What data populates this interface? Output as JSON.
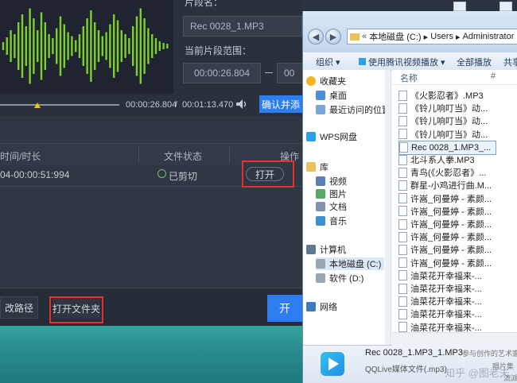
{
  "app": {
    "segment_name_label": "片段名：",
    "segment_name_value": "Rec 0028_1.MP3",
    "range_label": "当前片段范围：",
    "range_start": "00:00:26.804",
    "range_end_partial": "00",
    "current_time": "00:00:26.804",
    "total_time": "00:01:13.470",
    "confirm_button": "确认并添",
    "table": {
      "headers": {
        "time": "时间/时长",
        "status": "文件状态",
        "action": "操作"
      },
      "rows": [
        {
          "time": "04-00:00:51:994",
          "status": "已剪切",
          "action": "打开"
        }
      ]
    },
    "bottom": {
      "change_path": "改路径",
      "open_folder": "打开文件夹",
      "start_partial": "开"
    },
    "colors": {
      "accent": "#2f7ef0",
      "wave": "#7bcf2e",
      "highlight": "#e0332d"
    }
  },
  "explorer": {
    "address": {
      "part1": "本地磁盘 (C:)",
      "part2": "Users",
      "part3": "Administrator"
    },
    "commands": [
      "组织 ▾",
      "使用腾讯视频播放 ▾",
      "全部播放",
      "共享"
    ],
    "column_headers": {
      "name": "名称",
      "num": "#"
    },
    "nav": [
      {
        "label": "收藏夹",
        "icon": "star-icon"
      },
      {
        "label": "桌面",
        "icon": "desktop-icon"
      },
      {
        "label": "最近访问的位置",
        "icon": "recent-icon"
      },
      {
        "label": "WPS网盘",
        "icon": "cloud-icon"
      },
      {
        "label": "库",
        "icon": "library-icon"
      },
      {
        "label": "视频",
        "icon": "video-icon"
      },
      {
        "label": "图片",
        "icon": "picture-icon"
      },
      {
        "label": "文档",
        "icon": "document-icon"
      },
      {
        "label": "音乐",
        "icon": "music-icon"
      },
      {
        "label": "计算机",
        "icon": "computer-icon"
      },
      {
        "label": "本地磁盘 (C:)",
        "icon": "drive-icon"
      },
      {
        "label": "软件 (D:)",
        "icon": "drive-icon"
      },
      {
        "label": "网络",
        "icon": "network-icon"
      }
    ],
    "files": [
      "《火影忍者》.MP3",
      "《铃儿响叮当》动...",
      "《铃儿响叮当》动...",
      "《铃儿响叮当》动...",
      "Rec 0028_1.MP3_...",
      "北斗系人拳.MP3",
      "青鸟(《火影忍者》...",
      "群星-小鸡进行曲.M...",
      "许嵩_何曼婷 - 素颜...",
      "许嵩_何曼婷 - 素颜...",
      "许嵩_何曼婷 - 素颜...",
      "许嵩_何曼婷 - 素颜...",
      "许嵩_何曼婷 - 素颜...",
      "许嵩_何曼婷 - 素颜...",
      "油菜花开幸福来-...",
      "油菜花开幸福来-...",
      "油菜花开幸福来-...",
      "油菜花开幸福来-...",
      "油菜花开幸福来-...",
      "油菜花开幸福来-..."
    ],
    "details": {
      "filename": "Rec 0028_1.MP3_1.MP3",
      "type": "QQLive媒体文件(.mp3)",
      "extra1": "参与创作的艺术家",
      "extra2": "唱片集",
      "extra3": "流派",
      "watermark": "知乎 @图老夫"
    }
  }
}
